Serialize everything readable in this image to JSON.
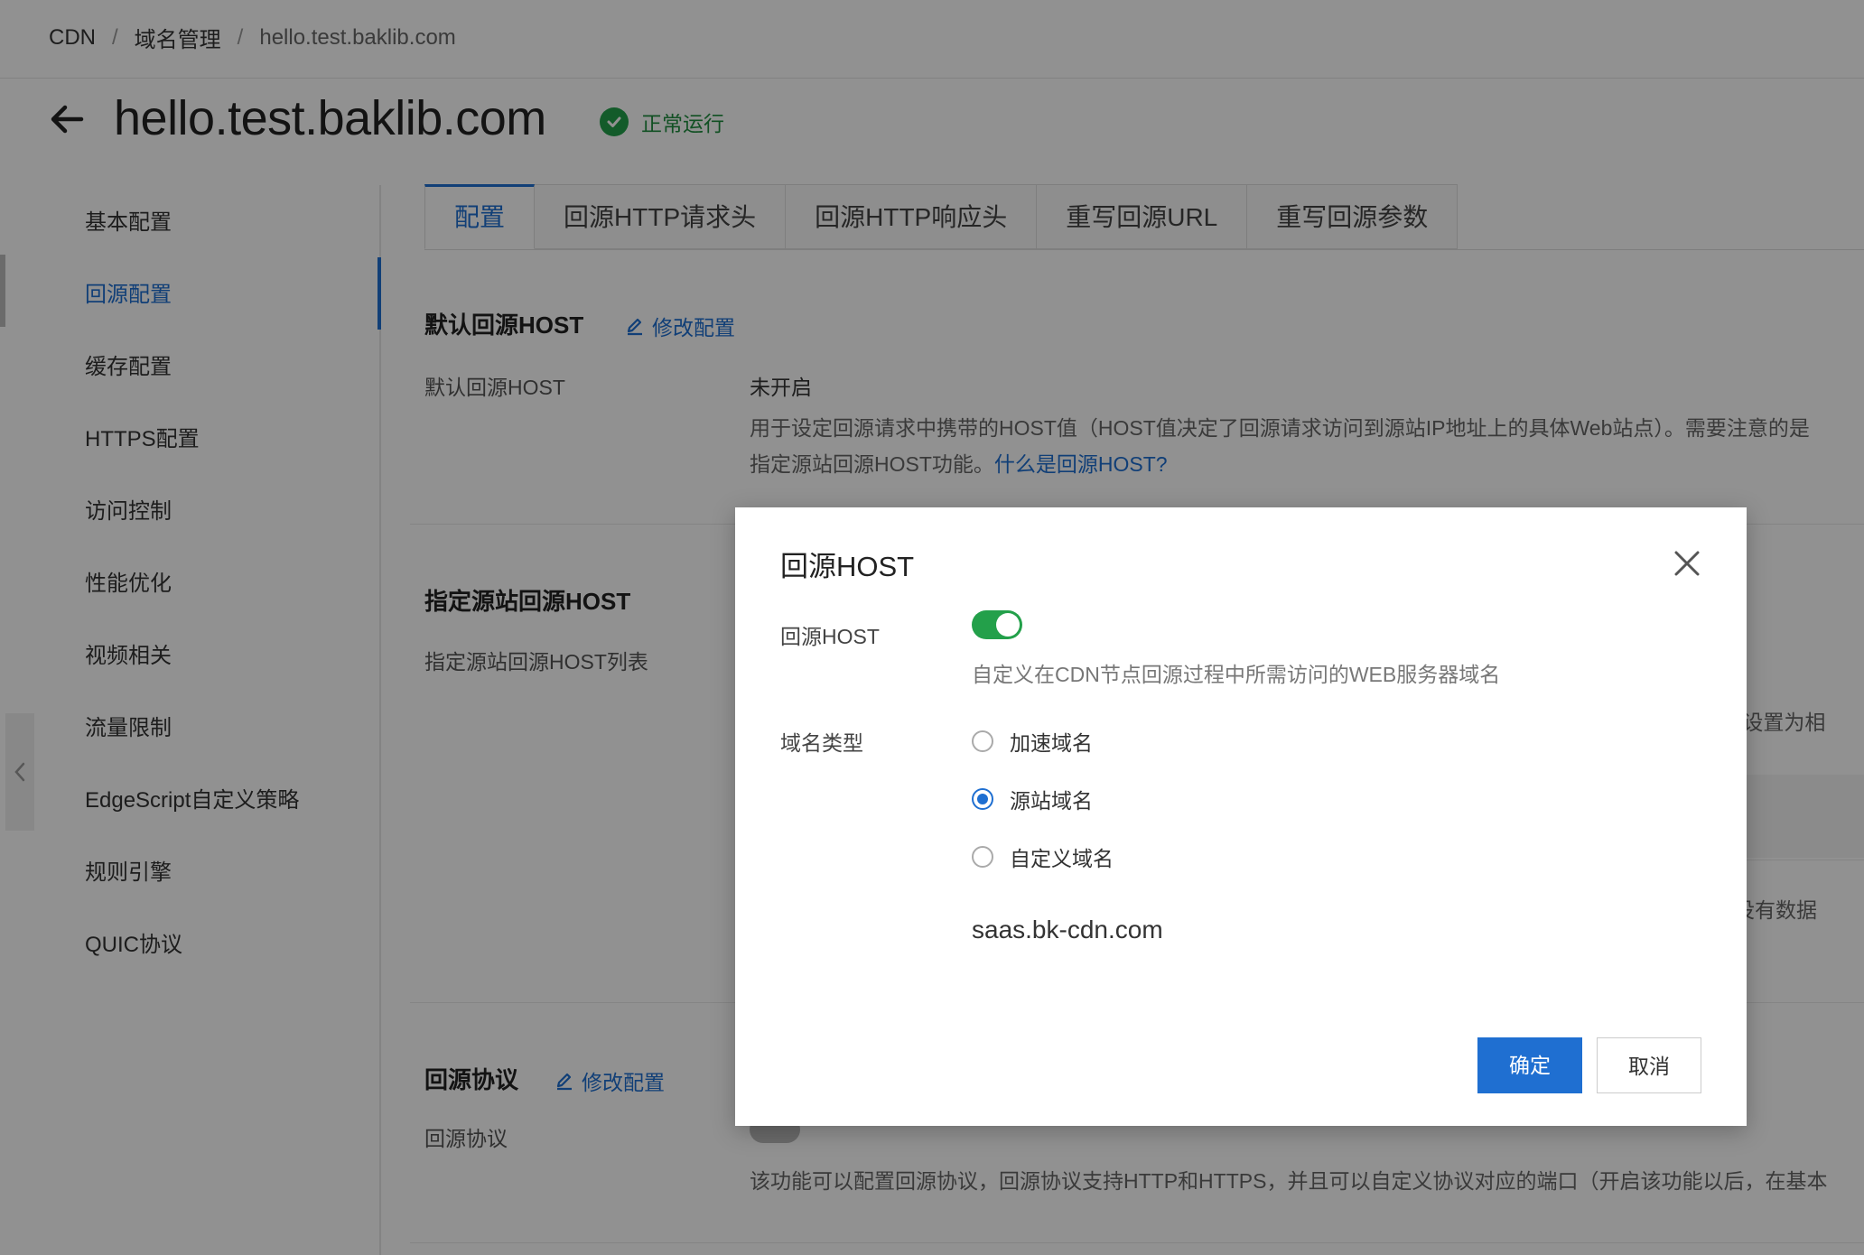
{
  "breadcrumb": {
    "items": [
      "CDN",
      "域名管理",
      "hello.test.baklib.com"
    ],
    "separator": "/"
  },
  "header": {
    "title": "hello.test.baklib.com",
    "status": "正常运行",
    "status_color": "#23a04a"
  },
  "sidebar": {
    "items": [
      {
        "label": "基本配置"
      },
      {
        "label": "回源配置",
        "active": true
      },
      {
        "label": "缓存配置"
      },
      {
        "label": "HTTPS配置"
      },
      {
        "label": "访问控制"
      },
      {
        "label": "性能优化"
      },
      {
        "label": "视频相关"
      },
      {
        "label": "流量限制"
      },
      {
        "label": "EdgeScript自定义策略"
      },
      {
        "label": "规则引擎"
      },
      {
        "label": "QUIC协议"
      }
    ]
  },
  "tabs": [
    {
      "label": "配置",
      "active": true
    },
    {
      "label": "回源HTTP请求头"
    },
    {
      "label": "回源HTTP响应头"
    },
    {
      "label": "重写回源URL"
    },
    {
      "label": "重写回源参数"
    }
  ],
  "sections": {
    "default_host": {
      "title": "默认回源HOST",
      "edit_label": "修改配置",
      "field_label": "默认回源HOST",
      "field_value": "未开启",
      "desc_line1": "用于设定回源请求中携带的HOST值（HOST值决定了回源请求访问到源站IP地址上的具体Web站点）。需要注意的是",
      "desc_line2": "指定源站回源HOST功能。",
      "desc_link": "什么是回源HOST?"
    },
    "origin_host": {
      "title": "指定源站回源HOST",
      "field_label": "指定源站回源HOST列表",
      "partial_text": "ST设置为相",
      "empty_text": "没有数据"
    },
    "protocol": {
      "title": "回源协议",
      "edit_label": "修改配置",
      "field_label": "回源协议",
      "desc": "该功能可以配置回源协议，回源协议支持HTTP和HTTPS，并且可以自定义协议对应的端口（开启该功能以后，在基本"
    }
  },
  "modal": {
    "title": "回源HOST",
    "toggle_label": "回源HOST",
    "toggle_on": true,
    "toggle_color": "#23a04a",
    "toggle_desc": "自定义在CDN节点回源过程中所需访问的WEB服务器域名",
    "domain_type_label": "域名类型",
    "options": [
      {
        "label": "加速域名",
        "selected": false
      },
      {
        "label": "源站域名",
        "selected": true
      },
      {
        "label": "自定义域名",
        "selected": false
      }
    ],
    "host_value": "saas.bk-cdn.com",
    "confirm_label": "确定",
    "cancel_label": "取消",
    "primary_color": "#1f6fd1"
  }
}
